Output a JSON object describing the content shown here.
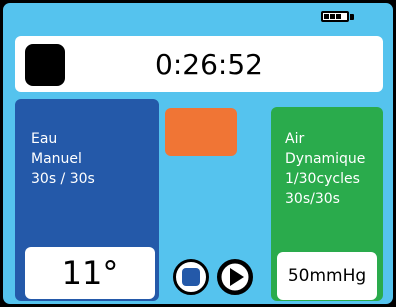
{
  "status": {
    "battery_icon": "battery-icon"
  },
  "timer": {
    "elapsed": "0:26:52"
  },
  "water_panel": {
    "lines": [
      "Eau",
      "Manuel",
      "30s / 30s"
    ],
    "temperature": "11°",
    "color": "#2459a9"
  },
  "air_panel": {
    "lines": [
      "Air",
      "Dynamique",
      "1/30cycles",
      "30s/30s"
    ],
    "pressure": "50mmHg",
    "color": "#2aab4c"
  },
  "controls": {
    "orange_button_color": "#f07535",
    "stop_icon": "stop-icon",
    "play_icon": "play-icon"
  }
}
